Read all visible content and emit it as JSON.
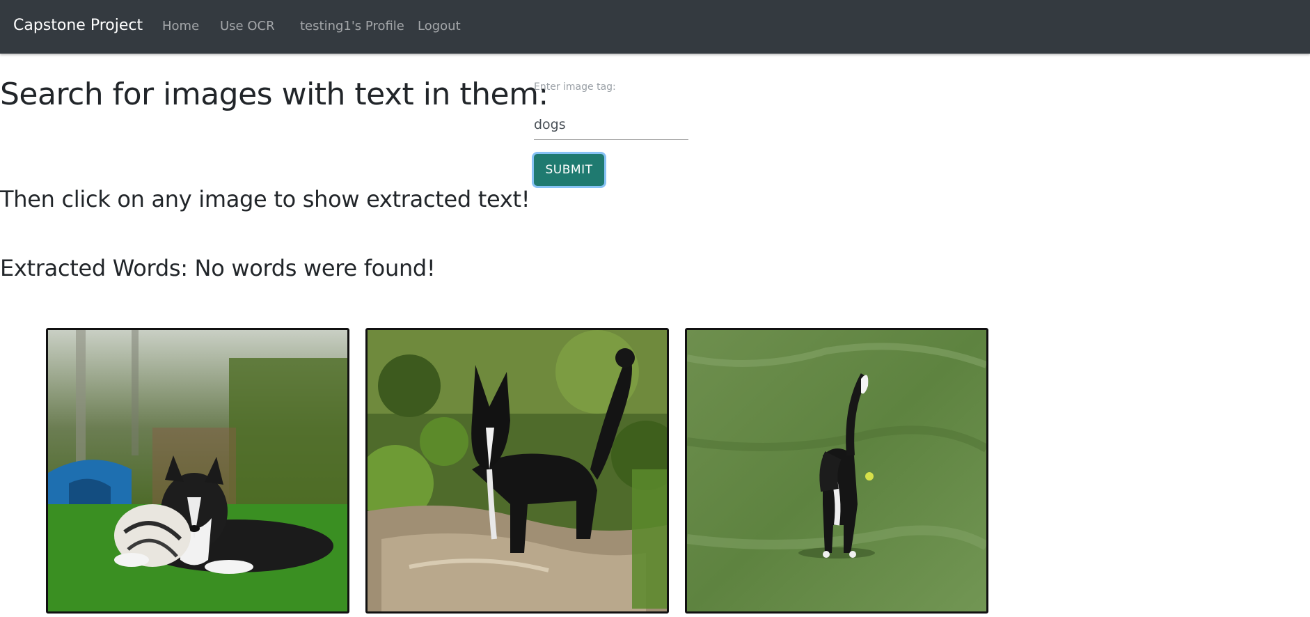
{
  "navbar": {
    "brand": "Capstone Project",
    "links": [
      {
        "label": "Home"
      },
      {
        "label": "Use OCR"
      },
      {
        "label": "testing1's Profile"
      },
      {
        "label": "Logout"
      }
    ]
  },
  "search": {
    "heading": "Search for images with text in them:",
    "field_label": "Enter image tag:",
    "value": "dogs",
    "submit_label": "SUBMIT"
  },
  "instructions": "Then click on any image to show extracted text!",
  "extracted_words": "Extracted Words: No words were found!",
  "gallery": [
    {
      "depiction": "border-collie-lying-on-grass-with-toy"
    },
    {
      "depiction": "black-dog-standing-in-muddy-stream"
    },
    {
      "depiction": "black-dog-standing-on-grass-field"
    }
  ],
  "colors": {
    "navbar": "#343a40",
    "submit_button": "#1f7a70",
    "focus_ring": "#87c2f5"
  }
}
